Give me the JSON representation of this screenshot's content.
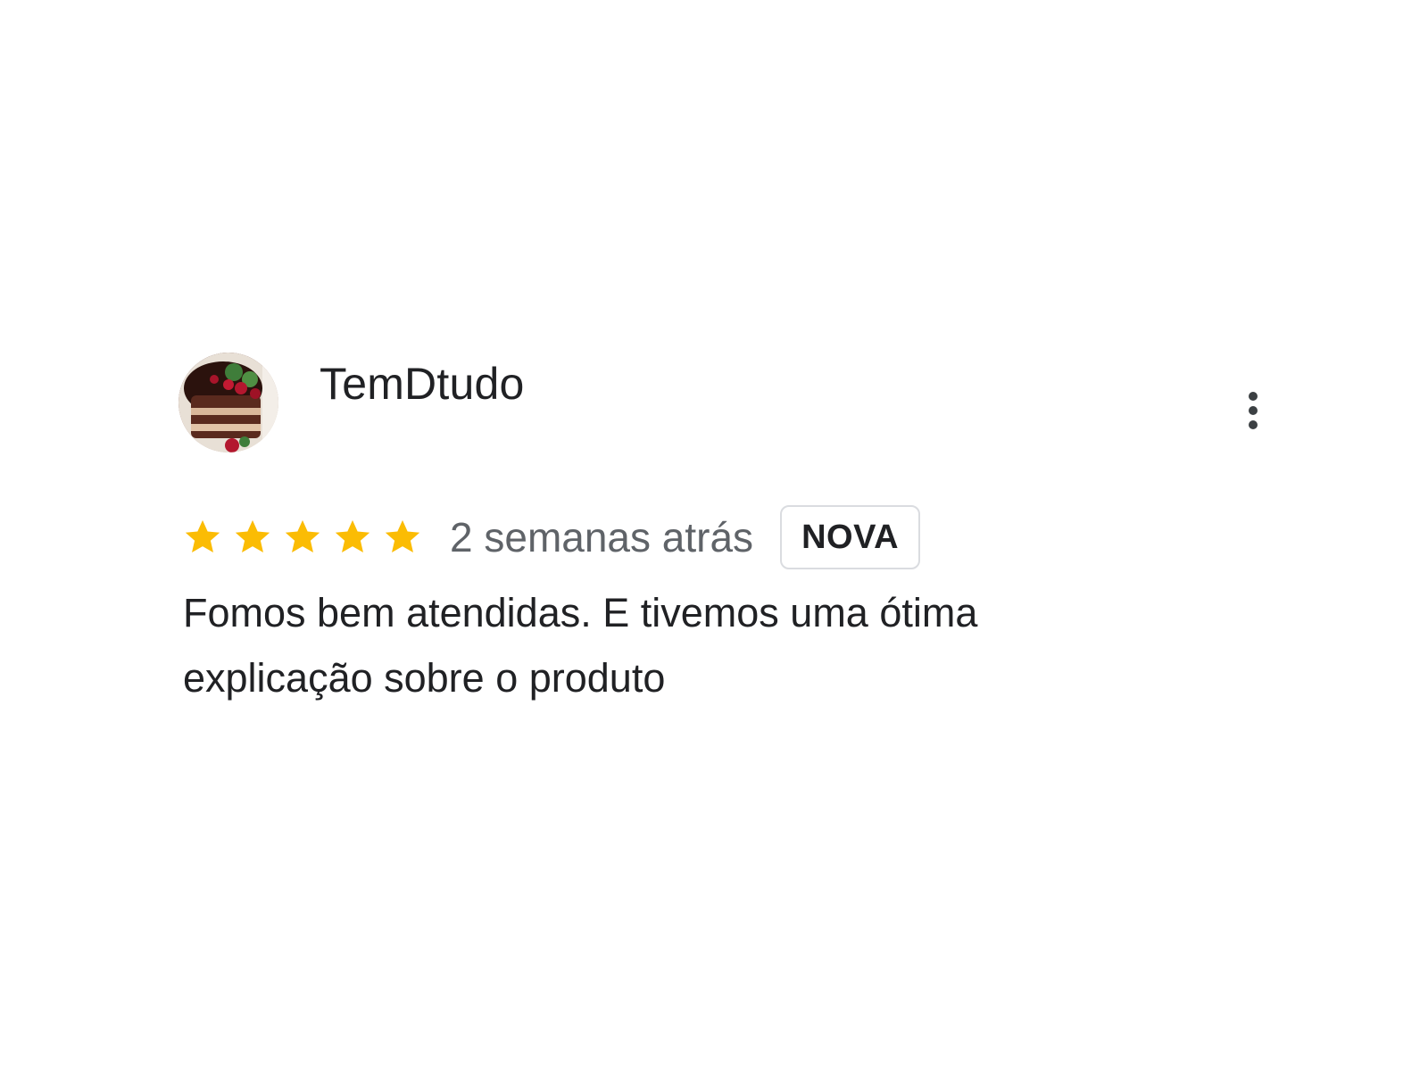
{
  "review": {
    "reviewer_name": "TemDtudo",
    "avatar_icon": "cake-photo-avatar",
    "rating": 5,
    "rating_max": 5,
    "date": "2 semanas atrás",
    "badge": "NOVA",
    "text": "Fomos bem atendidas. E tivemos uma ótima explicação sobre o produto",
    "more_icon": "more-vert-icon"
  },
  "colors": {
    "star": "#FBBC04",
    "name": "#202124",
    "date": "#5F6368",
    "badge_border": "#DADCE0"
  }
}
